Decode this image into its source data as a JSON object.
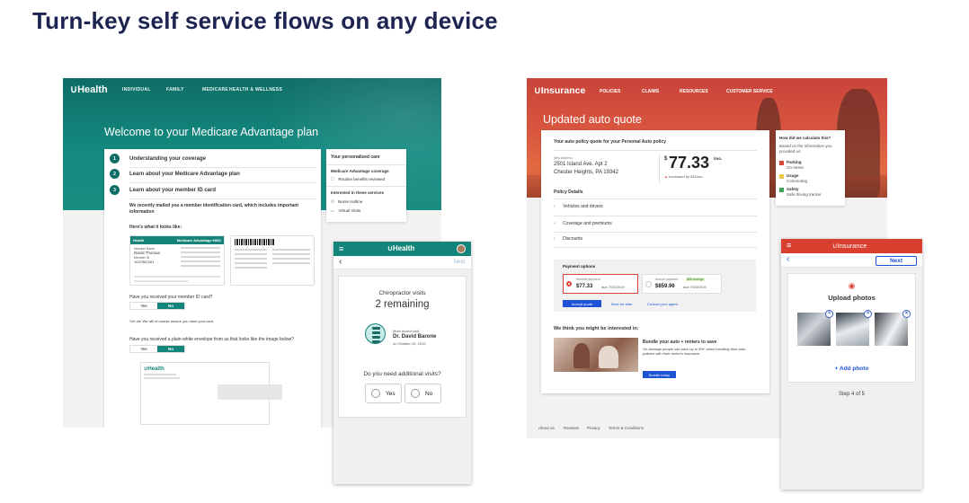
{
  "headline": "Turn-key self service flows on any device",
  "health_desktop": {
    "logo": "Health",
    "nav": [
      "INDIVIDUAL",
      "FAMILY",
      "MEDICARE",
      "HEALTH & WELLNESS"
    ],
    "title": "Welcome to your Medicare Advantage plan",
    "steps": [
      {
        "num": "1",
        "label": "Understanding your coverage"
      },
      {
        "num": "2",
        "label": "Learn about your Medicare Advantage plan"
      },
      {
        "num": "3",
        "label": "Learn about your member ID card"
      }
    ],
    "mailed_text": "We recently mailed you a member identification card, which includes important information",
    "looks_like": "Here's what it looks like:",
    "card_brand": "Health",
    "card_plan": "Medicare Advantage HMO",
    "card_member_name_label": "Member Name",
    "card_member_name": "David Thomas",
    "card_member_id_label": "Member ID",
    "card_member_id": "1037961301",
    "q1": "Have you received your member ID card?",
    "yes": "Yes",
    "no": "No",
    "uhoh": "*Uh oh! We will of course ensure you have your card.",
    "q2": "Have you received a plain-white envelope from us that looks like the image below?",
    "env_brand": "Health",
    "side_title": "Your personalized care",
    "side_cov": "Medicare Advantage coverage",
    "side_cov_item": "Routine benefits reviewed",
    "side_services": "Interested in these services",
    "side_s1": "Nurse Hotline",
    "side_s2": "Virtual Visits"
  },
  "health_mobile": {
    "logo": "Health",
    "back": "‹",
    "next": "Next",
    "visits_title": "Chiropractor visits",
    "remaining": "2 remaining",
    "recent_label": "Most recent visit:",
    "doctor": "Dr. David Barone",
    "visit_date": "on October 20, 2019",
    "question": "Do you need additional visits?",
    "yes": "Yes",
    "no": "No"
  },
  "insurance_desktop": {
    "logo": "Insurance",
    "nav": [
      "POLICIES",
      "CLAIMS",
      "RESOURCES",
      "CUSTOMER SERVICE"
    ],
    "title": "Updated auto quote",
    "quote_heading": "Your auto policy quote for your Personal Auto policy",
    "address_label": "New Address",
    "address1": "2501 Island Ave. Apt 2",
    "address2": "Chester Heights, PA 19342",
    "price_symbol": "$",
    "price": "77.33",
    "price_unit": "/mo.",
    "increase": "Increased by $15/mo.",
    "details_heading": "Policy Details",
    "rows": [
      "Vehicles and drivers",
      "Coverage and premiums",
      "Discounts"
    ],
    "payment_heading": "Payment options",
    "monthly_label": "Monthly payment",
    "monthly_amount": "$77.33",
    "monthly_due": "due 7/25/2019",
    "annual_label": "Annual payment",
    "annual_badge": "$68 savings",
    "annual_amount": "$859.96",
    "annual_due": "due 7/25/2019",
    "accept": "Accept quote",
    "save_later": "Save for later",
    "contact": "Contact your agent",
    "interested": "We think you might be interested in:",
    "bundle_title": "Bundle your auto + renters to save",
    "bundle_text": "On average people can save up to 5%* when bundling their auto policies with their renter's insurance.",
    "bundle_btn": "Bundle today",
    "calc_title": "How did we calculate this?",
    "calc_sub": "Based on the information you provided us:",
    "factors": [
      {
        "name": "Parking",
        "detail": "On-street",
        "color": "#d9473a"
      },
      {
        "name": "Usage",
        "detail": "Commuting",
        "color": "#e8c84a"
      },
      {
        "name": "Safety",
        "detail": "Safe driving tracker",
        "color": "#3fa45b"
      }
    ],
    "footer": [
      "About us",
      "Reviews",
      "Privacy",
      "Terms & Conditions"
    ]
  },
  "insurance_mobile": {
    "logo": "Insurance",
    "back": "‹",
    "next": "Next",
    "upload_title": "Upload photos",
    "add_photo": "+ Add photo",
    "step": "Step 4 of 5"
  }
}
